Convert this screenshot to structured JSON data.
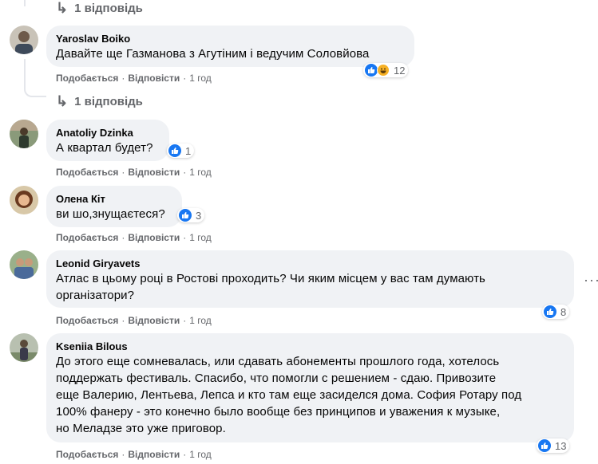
{
  "top_reply": {
    "label": "1 відповідь"
  },
  "comments": [
    {
      "author": "Yaroslav Boiko",
      "text": "Давайте ще Газманова з Агутіним і ведучим Соловйова",
      "like_label": "Подобається",
      "reply_label": "Відповісти",
      "time": "1 год",
      "reactions": [
        "like",
        "haha"
      ],
      "reaction_count": "12",
      "replies_label": "1 відповідь"
    },
    {
      "author": "Anatoliy Dzinka",
      "text": "А квартал будет?",
      "like_label": "Подобається",
      "reply_label": "Відповісти",
      "time": "1 год",
      "reactions": [
        "like"
      ],
      "reaction_count": "1"
    },
    {
      "author": "Олена Кіт",
      "text": "ви шо,знущаєтеся?",
      "like_label": "Подобається",
      "reply_label": "Відповісти",
      "time": "1 год",
      "reactions": [
        "like"
      ],
      "reaction_count": "3"
    },
    {
      "author": "Leonid Giryavets",
      "text": "Атлас в цьому році в Ростові проходить? Чи яким місцем у вас там думають організатори?",
      "text_lines": [
        "Атлас в цьому році в Ростові проходить? Чи яким місцем у вас там думають",
        "організатори?"
      ],
      "like_label": "Подобається",
      "reply_label": "Відповісти",
      "time": "1 год",
      "reactions": [
        "like"
      ],
      "reaction_count": "8",
      "more_icon": "more-horizontal-icon"
    },
    {
      "author": "Kseniia Bilous",
      "text_lines": [
        "До этого еще сомневалась, или сдавать абонементы прошлого года, хотелось",
        "поддержать фестиваль. Спасибо, что помогли с решением - сдаю. Привозите",
        "еще Валерию, Лентьева, Лепса и кто там еще засиделся дома. София Ротару под",
        "100% фанеру - это конечно было вообще без принципов и уважения к музыке,",
        "но Меладзе это уже приговор."
      ],
      "like_label": "Подобається",
      "reply_label": "Відповісти",
      "time": "1 год",
      "reactions": [
        "like"
      ],
      "reaction_count": "13"
    }
  ],
  "colors": {
    "bubble": "#f0f2f5",
    "like": "#1877f2",
    "haha": "#f7b125",
    "meta": "#65676b"
  }
}
